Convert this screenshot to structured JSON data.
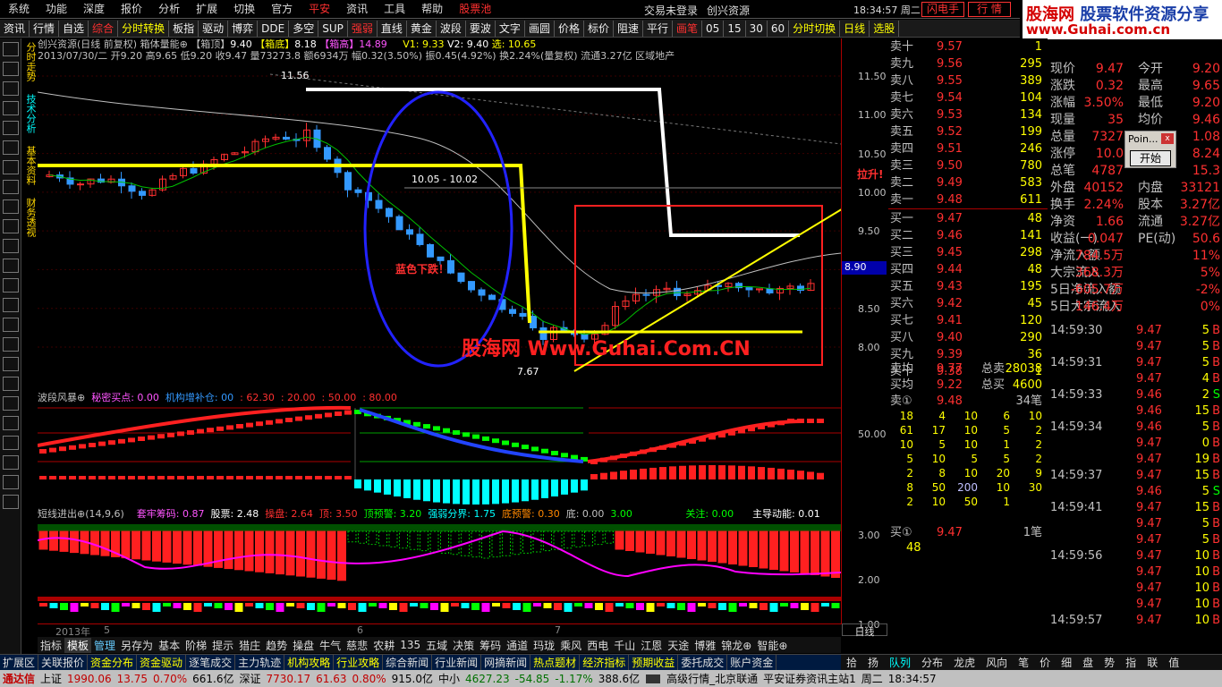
{
  "menu": [
    "系统",
    "功能",
    "深度",
    "报价",
    "分析",
    "扩展",
    "切换",
    "官方",
    "平安",
    "资讯",
    "工具",
    "帮助",
    "股票池"
  ],
  "status_center": "交易未登录",
  "brand_center": "创兴资源",
  "clock": "18:34:57 周二",
  "buttons_top": {
    "flash": "闪电手",
    "quote": "行 情"
  },
  "logo": {
    "line1a": "股海网",
    "line1b": "股票软件资源分享",
    "line2": "www.Guhai.com.cn"
  },
  "toolbar": [
    "资讯",
    "行情",
    "自选",
    "综合",
    "分时转换",
    "板指",
    "驱动",
    "博弈",
    "DDE",
    "多空",
    "SUP",
    "强弱",
    "直线",
    "黄金",
    "波段",
    "要波",
    "文字",
    "画圆",
    "价格",
    "标价",
    "阻速",
    "平行",
    "画笔",
    "05",
    "15",
    "30",
    "60",
    "分时切换",
    "日线",
    "选股"
  ],
  "left_vtabs": [
    "分时走势",
    "技术分析",
    "基本资料",
    "财务透视"
  ],
  "chart_info": {
    "line1": "创兴资源(日线 前复权) 箱体量能⊕",
    "box_top_label": "【箱顶】",
    "box_top": "9.40",
    "box_bottom_label": "【箱底】",
    "box_bottom": "8.18",
    "box_high_label": "【箱高】",
    "box_high": "14.89",
    "v1": "V1: 9.33",
    "v2": "V2: 9.40",
    "sel": "选: 10.65",
    "line2": "2013/07/30/二  开9.20 高9.65 低9.20 收9.47 量73273.8 额6934万 幅0.32(3.50%) 振0.45(4.92%) 换2.24%(量复权) 流通3.27亿 区域地产"
  },
  "annotations": {
    "max_label": "11.56",
    "min_label": "7.67",
    "range_label": "10.05 - 10.02",
    "fall_label": "蓝色下跌！",
    "rise_label": "拉升!",
    "watermark": "股海网 Www.Guhai.Com.CN"
  },
  "yaxis_main": [
    "11.50",
    "11.00",
    "10.50",
    "10.00",
    "9.50",
    "9.00",
    "8.50",
    "8.00"
  ],
  "price_tag": "8.90",
  "ind1": {
    "title": "波段风暴⊕",
    "secret_buy": "秘密买点: 0.00",
    "inst_add": "机构增补仓: 00",
    "v1": ": 62.30",
    "v2": ": 20.00",
    "v3": ": 50.00",
    "v4": ": 80.00",
    "ylab": "50.00"
  },
  "ind2": {
    "title": "短线进出⊕(14,9,6)",
    "tao": "套牢筹码: 0.87",
    "stock": "股票: 2.48",
    "ctrl": "操盘: 2.64",
    "top": "顶: 3.50",
    "top_warn": "顶预警: 3.20",
    "strong": "强弱分界: 1.75",
    "bottom_warn": "底预警: 0.30",
    "bottom": "底: 0.00",
    "val": "3.00",
    "focus": "关注: 0.00",
    "main_force": "主导动能: 0.01",
    "ylabs": [
      "3.00",
      "2.00",
      "1.00"
    ]
  },
  "xaxis": [
    "2013年",
    "5",
    "6",
    "7"
  ],
  "period": "日线",
  "bottom_tabs": [
    "指标",
    "模板",
    "管理",
    "另存为",
    "基本",
    "阶梯",
    "提示",
    "猎庄",
    "趋势",
    "操盘",
    "牛气",
    "慈悲",
    "农耕",
    "135",
    "五域",
    "决策",
    "筹码",
    "通道",
    "玛珑",
    "乘风",
    "西电",
    "千山",
    "江恩",
    "天途",
    "博雅",
    "锦龙⊕",
    "智能⊕"
  ],
  "func_bar": [
    "扩展区",
    "关联报价",
    "资金分布",
    "资金驱动",
    "逐笔成交",
    "主力轨迹",
    "机构攻略",
    "行业攻略",
    "综合新闻",
    "行业新闻",
    "网摘新闻",
    "热点题材",
    "经济指标",
    "预期收益",
    "委托成交",
    "账户资金"
  ],
  "orderbook": {
    "sells": [
      {
        "label": "卖十",
        "price": "9.57",
        "vol": "1"
      },
      {
        "label": "卖九",
        "price": "9.56",
        "vol": "295"
      },
      {
        "label": "卖八",
        "price": "9.55",
        "vol": "389"
      },
      {
        "label": "卖七",
        "price": "9.54",
        "vol": "104"
      },
      {
        "label": "卖六",
        "price": "9.53",
        "vol": "134"
      },
      {
        "label": "卖五",
        "price": "9.52",
        "vol": "199"
      },
      {
        "label": "卖四",
        "price": "9.51",
        "vol": "246"
      },
      {
        "label": "卖三",
        "price": "9.50",
        "vol": "780"
      },
      {
        "label": "卖二",
        "price": "9.49",
        "vol": "583"
      },
      {
        "label": "卖一",
        "price": "9.48",
        "vol": "611"
      }
    ],
    "buys": [
      {
        "label": "买一",
        "price": "9.47",
        "vol": "48"
      },
      {
        "label": "买二",
        "price": "9.46",
        "vol": "141"
      },
      {
        "label": "买三",
        "price": "9.45",
        "vol": "298"
      },
      {
        "label": "买四",
        "price": "9.44",
        "vol": "48"
      },
      {
        "label": "买五",
        "price": "9.43",
        "vol": "195"
      },
      {
        "label": "买六",
        "price": "9.42",
        "vol": "45"
      },
      {
        "label": "买七",
        "price": "9.41",
        "vol": "120"
      },
      {
        "label": "买八",
        "price": "9.40",
        "vol": "290"
      },
      {
        "label": "买九",
        "price": "9.39",
        "vol": "36"
      },
      {
        "label": "买十",
        "price": "9.38",
        "vol": "1"
      }
    ],
    "avg_sell_label": "卖均",
    "avg_sell": "9.77",
    "total_sell_label": "总卖",
    "total_sell": "28038",
    "avg_buy_label": "买均",
    "avg_buy": "9.22",
    "total_buy_label": "总买",
    "total_buy": "4600",
    "queue_sell_label": "卖①",
    "queue_sell_price": "9.48",
    "queue_sell_count": "34笔",
    "queue_sell_rows": [
      [
        "18",
        "4",
        "10",
        "6",
        "10"
      ],
      [
        "61",
        "17",
        "10",
        "5",
        "2"
      ],
      [
        "10",
        "5",
        "10",
        "1",
        "2"
      ],
      [
        "5",
        "10",
        "5",
        "5",
        "2"
      ],
      [
        "2",
        "8",
        "10",
        "20",
        "9"
      ],
      [
        "8",
        "50",
        "200",
        "10",
        "30"
      ],
      [
        "2",
        "10",
        "50",
        "1",
        ""
      ]
    ],
    "queue_buy_label": "买①",
    "queue_buy_price": "9.47",
    "queue_buy_count": "1笔",
    "queue_buy_vol": "48"
  },
  "stats": [
    {
      "a": "现价",
      "b": "9.47",
      "c": "今开",
      "d": "9.20"
    },
    {
      "a": "涨跌",
      "b": "0.32",
      "c": "最高",
      "d": "9.65"
    },
    {
      "a": "涨幅",
      "b": "3.50%",
      "c": "最低",
      "d": "9.20"
    },
    {
      "a": "现量",
      "b": "35",
      "c": "均价",
      "d": "9.46"
    },
    {
      "a": "总量",
      "b": "7327",
      "c": "",
      "d": "1.08"
    },
    {
      "a": "涨停",
      "b": "10.0",
      "c": "",
      "d": "8.24"
    },
    {
      "a": "总笔",
      "b": "4787",
      "c": "",
      "d": "15.3"
    },
    {
      "a": "外盘",
      "b": "40152",
      "c": "内盘",
      "d": "33121"
    },
    {
      "a": "换手",
      "b": "2.24%",
      "c": "股本",
      "d": "3.27亿"
    },
    {
      "a": "净资",
      "b": "1.66",
      "c": "流通",
      "d": "3.27亿"
    },
    {
      "a": "收益(一)",
      "b": "0.047",
      "c": "PE(动)",
      "d": "50.6"
    },
    {
      "a": "净流入额",
      "b": "784.5万",
      "c": "",
      "d": "11%"
    },
    {
      "a": "大宗流入",
      "b": "368.3万",
      "c": "",
      "d": "5%"
    },
    {
      "a": "5日净流入额",
      "b": "-605.7万",
      "c": "",
      "d": "-2%"
    },
    {
      "a": "5日大宗流入",
      "b": "146.4万",
      "c": "",
      "d": "0%"
    }
  ],
  "popup": {
    "title": "Poin...",
    "close": "x",
    "button": "开始"
  },
  "ticks": [
    {
      "t": "14:59:30",
      "p": "9.47",
      "v": "5",
      "f": "B"
    },
    {
      "t": "",
      "p": "9.47",
      "v": "5",
      "f": "B"
    },
    {
      "t": "14:59:31",
      "p": "9.47",
      "v": "5",
      "f": "B"
    },
    {
      "t": "",
      "p": "9.47",
      "v": "4",
      "f": "B"
    },
    {
      "t": "14:59:33",
      "p": "9.46",
      "v": "2",
      "f": "S"
    },
    {
      "t": "",
      "p": "9.46",
      "v": "15",
      "f": "B"
    },
    {
      "t": "14:59:34",
      "p": "9.46",
      "v": "5",
      "f": "B"
    },
    {
      "t": "",
      "p": "9.47",
      "v": "0",
      "f": "B"
    },
    {
      "t": "",
      "p": "9.47",
      "v": "19",
      "f": "B"
    },
    {
      "t": "14:59:37",
      "p": "9.47",
      "v": "15",
      "f": "B"
    },
    {
      "t": "",
      "p": "9.46",
      "v": "5",
      "f": "S"
    },
    {
      "t": "14:59:41",
      "p": "9.47",
      "v": "15",
      "f": "B"
    },
    {
      "t": "",
      "p": "9.47",
      "v": "5",
      "f": "B"
    },
    {
      "t": "",
      "p": "9.47",
      "v": "5",
      "f": "B"
    },
    {
      "t": "14:59:56",
      "p": "9.47",
      "v": "10",
      "f": "B"
    },
    {
      "t": "",
      "p": "9.47",
      "v": "10",
      "f": "B"
    },
    {
      "t": "",
      "p": "9.47",
      "v": "10",
      "f": "B"
    },
    {
      "t": "",
      "p": "9.47",
      "v": "10",
      "f": "B"
    },
    {
      "t": "14:59:57",
      "p": "9.47",
      "v": "10",
      "f": "B"
    }
  ],
  "tick_side_labels": [
    "",
    "4",
    "",
    "",
    "",
    "2",
    "",
    "1",
    "",
    "",
    "2",
    "",
    "1",
    "3",
    "2",
    "3",
    "4"
  ],
  "right_tabs": [
    "拾",
    "扬",
    "队列",
    "分布",
    "龙虎",
    "风向",
    "笔",
    "价",
    "细",
    "盘",
    "势",
    "指",
    "联",
    "值"
  ],
  "statusbar": {
    "app": "通达信",
    "sh_label": "上证",
    "sh": "1990.06",
    "sh_chg": "13.75",
    "sh_pct": "0.70%",
    "sh_amt": "661.6亿",
    "sz_label": "深证",
    "sz": "7730.17",
    "sz_chg": "61.63",
    "sz_pct": "0.80%",
    "sz_amt": "915.0亿",
    "zx_label": "中小",
    "zx": "4627.23",
    "zx_chg": "-54.85",
    "zx_pct": "-1.17%",
    "zx_amt": "388.6亿",
    "server": "高级行情_北京联通",
    "site": "平安证券资讯主站1",
    "day": "周二",
    "time": "18:34:57"
  }
}
